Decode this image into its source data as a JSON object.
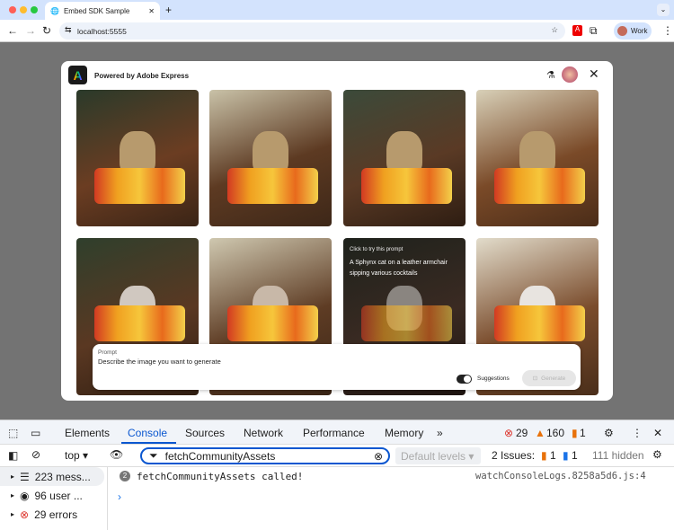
{
  "browser": {
    "tab_title": "Embed SDK Sample",
    "url": "localhost:5555",
    "profile": "Work"
  },
  "modal": {
    "header": "Powered by Adobe Express",
    "hover_card": {
      "hint": "Click to try this prompt",
      "prompt": "A Sphynx cat on a leather armchair sipping various cocktails"
    },
    "prompt": {
      "label": "Prompt",
      "placeholder": "Describe the image you want to generate",
      "suggestions_label": "Suggestions",
      "suggestions_on": true,
      "generate_label": "Generate"
    }
  },
  "devtools": {
    "tabs": [
      "Elements",
      "Console",
      "Sources",
      "Network",
      "Performance",
      "Memory"
    ],
    "active_tab": "Console",
    "errors": "29",
    "warnings": "160",
    "issues_badge": "1",
    "context": "top",
    "filter": "fetchCommunityAssets",
    "levels": "Default levels",
    "issues_label": "2 Issues:",
    "issues_err": "1",
    "issues_info": "1",
    "hidden": "111 hidden",
    "sidebar": [
      {
        "label": "223 mess..."
      },
      {
        "label": "96 user ..."
      },
      {
        "label": "29 errors"
      }
    ],
    "log": {
      "count": "2",
      "message": "fetchCommunityAssets called!",
      "source": "watchConsoleLogs.8258a5d6.js:4"
    }
  }
}
